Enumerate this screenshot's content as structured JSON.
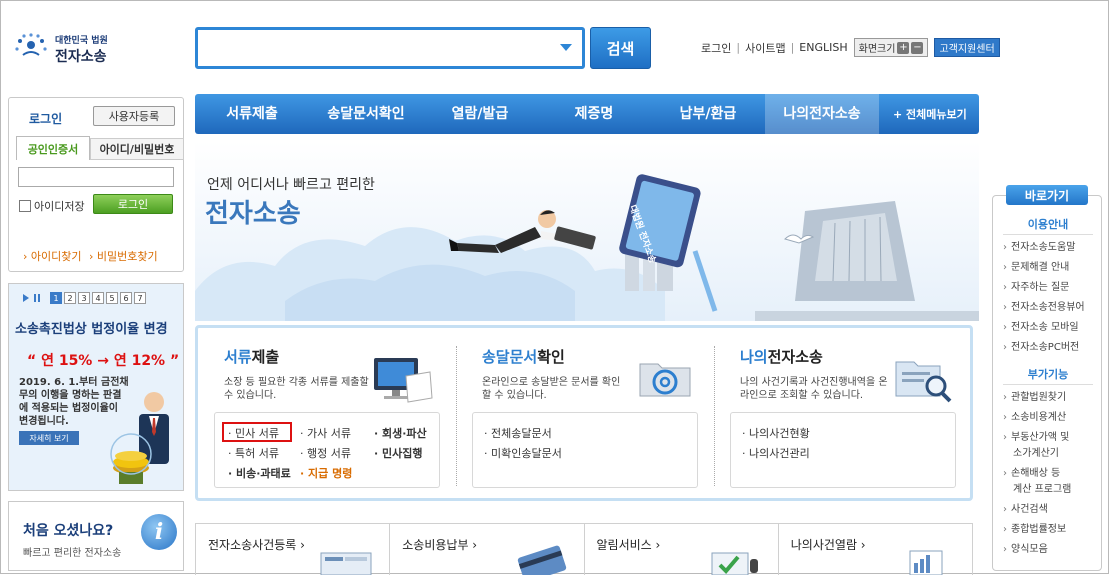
{
  "header": {
    "logo_line1": "대한민국 법원",
    "logo_line2": "전자소송",
    "search_button": "검색",
    "links": [
      "로그인",
      "사이트맵",
      "ENGLISH"
    ],
    "zoom_label": "화면크기",
    "zoom_plus": "+",
    "zoom_minus": "−",
    "support_label": "고객지원센터"
  },
  "nav": {
    "items": [
      "서류제출",
      "송달문서확인",
      "열람/발급",
      "제증명",
      "납부/환급",
      "나의전자소송"
    ],
    "active_index": 5,
    "all_menu": "+ 전체메뉴보기"
  },
  "login": {
    "title": "로그인",
    "register_button": "사용자등록",
    "tab_cert": "공인인증서",
    "tab_id": "아이디/비밀번호",
    "save_id": "아이디저장",
    "login_button": "로그인",
    "find_id": "› 아이디찾기",
    "find_pw": "› 비밀번호찾기"
  },
  "notice": {
    "pages": [
      "1",
      "2",
      "3",
      "4",
      "5",
      "6",
      "7"
    ],
    "title": "소송촉진법상 법정이율 변경",
    "rate_text": "“ 연 15% → 연 12% ”",
    "desc": "2019. 6. 1.부터 금전채무의 이행을 명하는 판결에 적용되는 법정이율이 변경됩니다.",
    "more": "자세히 보기"
  },
  "welcome": {
    "title": "처음 오셨나요?",
    "subtitle": "빠르고 편리한 전자소송",
    "icon_letter": "i"
  },
  "hero": {
    "tagline": "언제 어디서나 빠르고 편리한",
    "title": "전자소송",
    "card_text": "대법원 전자소송"
  },
  "services": {
    "col1": {
      "title_hl": "서류",
      "title_rest": "제출",
      "desc": "소장 등 필요한 각종 서류를 제출할 수 있습니다.",
      "links": [
        "· 민사 서류",
        "· 가사 서류",
        "· 회생·파산",
        "· 특허 서류",
        "· 행정 서류",
        "· 민사집행",
        "· 비송·과태료",
        "· 지급 명령"
      ]
    },
    "col2": {
      "title_hl": "송달문서",
      "title_rest": "확인",
      "desc": "온라인으로 송달받은 문서를 확인 할 수 있습니다.",
      "links": [
        "· 전체송달문서",
        "· 미확인송달문서"
      ]
    },
    "col3": {
      "title_hl": "나의",
      "title_rest": "전자소송",
      "desc": "나의 사건기록과 사건진행내역을 온라인으로 조회할 수 있습니다.",
      "links": [
        "· 나의사건현황",
        "· 나의사건관리"
      ]
    }
  },
  "tiles": [
    "전자소송사건등록 ›",
    "소송비용납부 ›",
    "알림서비스 ›",
    "나의사건열람 ›"
  ],
  "quick": {
    "header": "바로가기",
    "section1": "이용안내",
    "items1": [
      "전자소송도움말",
      "문제해결 안내",
      "자주하는 질문",
      "전자소송전용뷰어",
      "전자소송 모바일",
      "전자소송PC버전"
    ],
    "section2": "부가기능",
    "items2": [
      "관할법원찾기",
      "소송비용계산",
      "부동산가액 및",
      "소가계산기",
      "손해배상 등",
      "계산 프로그램",
      "사건검색",
      "종합법률정보",
      "양식모음"
    ]
  },
  "colors": {
    "primary": "#2d86d6",
    "nav_top": "#3f97e3",
    "nav_bottom": "#1f68bc",
    "green": "#4c9f22",
    "orange": "#d86b00",
    "red": "#dd1111"
  }
}
